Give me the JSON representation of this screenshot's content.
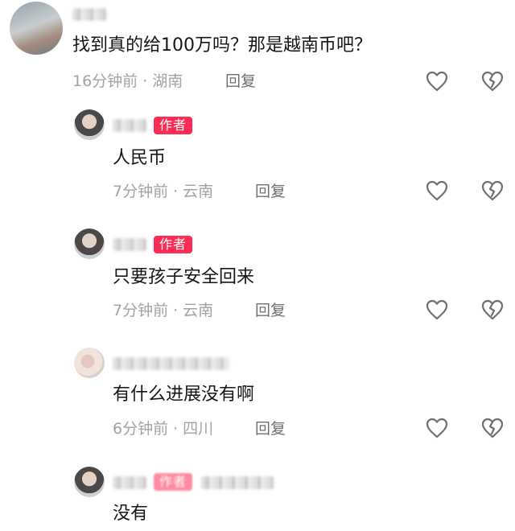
{
  "comments": [
    {
      "id": "c1",
      "text": "找到真的给100万吗？那是越南币吧？",
      "time": "16分钟前",
      "location": "湖南",
      "reply_label": "回复",
      "like_icon": "heart-outline-icon",
      "dislike_icon": "broken-heart-icon"
    },
    {
      "id": "c2",
      "author_badge": "作者",
      "text": "人民币",
      "time": "7分钟前",
      "location": "云南",
      "reply_label": "回复",
      "like_icon": "heart-outline-icon",
      "dislike_icon": "broken-heart-icon"
    },
    {
      "id": "c3",
      "author_badge": "作者",
      "text": "只要孩子安全回来",
      "time": "7分钟前",
      "location": "云南",
      "reply_label": "回复",
      "like_icon": "heart-outline-icon",
      "dislike_icon": "broken-heart-icon"
    },
    {
      "id": "c4",
      "text": "有什么进展没有啊",
      "time": "6分钟前",
      "location": "四川",
      "reply_label": "回复",
      "like_icon": "heart-outline-icon",
      "dislike_icon": "broken-heart-icon"
    },
    {
      "id": "c5",
      "author_badge": "作者",
      "text": "没有"
    }
  ],
  "meta_separator": "·",
  "colors": {
    "badge": "#fe2c55",
    "meta_text": "#a2a2a2",
    "body_text": "#161616",
    "icon": "#6f6f6f"
  }
}
